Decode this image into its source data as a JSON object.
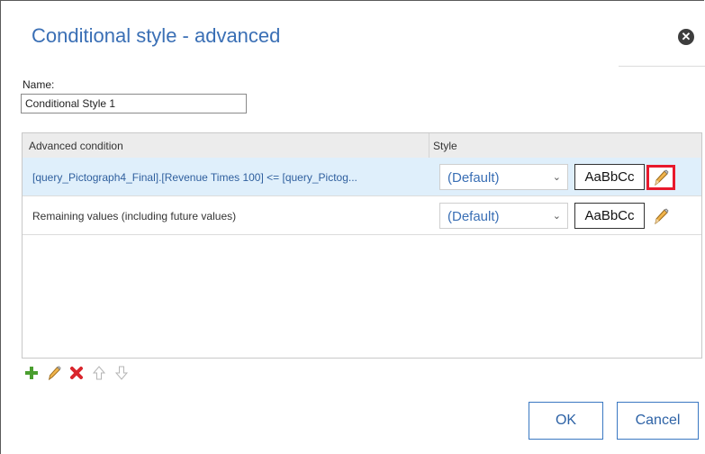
{
  "dialog": {
    "title": "Conditional style - advanced",
    "close_icon": "close-circle-icon"
  },
  "name_field": {
    "label": "Name:",
    "value": "Conditional Style 1"
  },
  "grid": {
    "columns": [
      "Advanced condition",
      "Style"
    ],
    "rows": [
      {
        "condition": "[query_Pictograph4_Final].[Revenue Times 100] <= [query_Pictog...",
        "style": "(Default)",
        "sample": "AaBbCc",
        "selected": true
      },
      {
        "condition": "Remaining values (including future values)",
        "style": "(Default)",
        "sample": "AaBbCc",
        "selected": false
      }
    ]
  },
  "toolbar": {
    "icons": [
      "add-icon",
      "edit-icon",
      "delete-icon",
      "move-up-icon",
      "move-down-icon"
    ]
  },
  "buttons": {
    "ok": "OK",
    "cancel": "Cancel"
  },
  "colors": {
    "title": "#3a6fb5",
    "selected_row": "#dfeffb",
    "highlight": "#e8192c",
    "add_green": "#4a9e2f",
    "delete_red": "#d9252c"
  }
}
